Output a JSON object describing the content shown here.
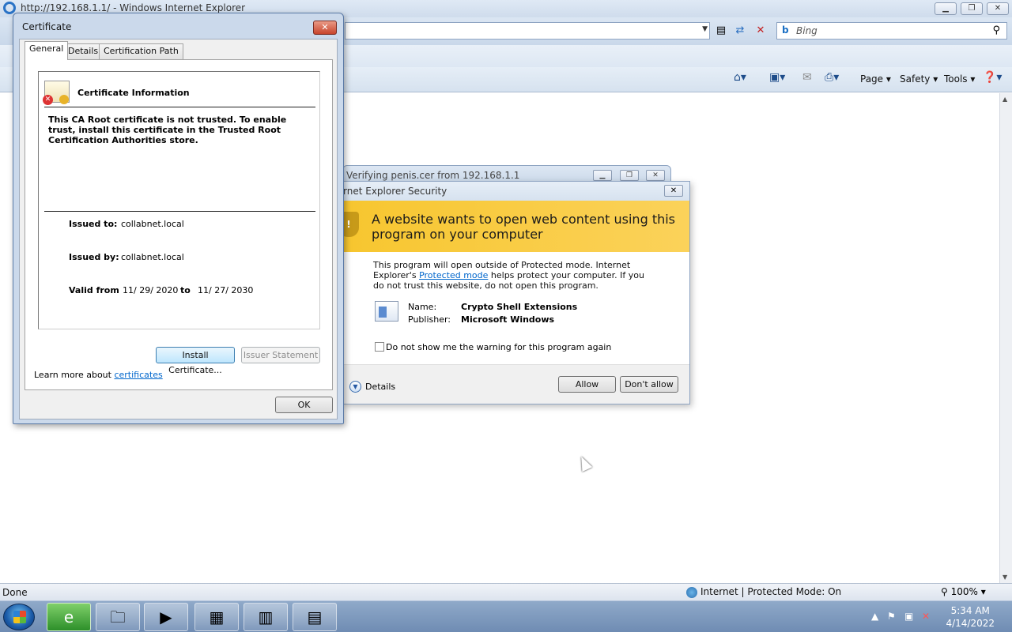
{
  "ie": {
    "title": "http://192.168.1.1/ - Windows Internet Explorer",
    "search_placeholder": "Bing",
    "commands": [
      "Page",
      "Safety",
      "Tools"
    ],
    "status": "Done",
    "zone": "Internet | Protected Mode: On",
    "zoom": "100%"
  },
  "certificate": {
    "title": "Certificate",
    "tabs": [
      "General",
      "Details",
      "Certification Path"
    ],
    "info_title": "Certificate Information",
    "warning": "This CA Root certificate is not trusted. To enable trust, install this certificate in the Trusted Root Certification Authorities store.",
    "issued_to_label": "Issued to:",
    "issued_to": "collabnet.local",
    "issued_by_label": "Issued by:",
    "issued_by": "collabnet.local",
    "valid_from_label": "Valid from",
    "valid_from": "11/ 29/ 2020",
    "to_label": "to",
    "valid_to": "11/ 27/ 2030",
    "install_button": "Install Certificate...",
    "issuer_button": "Issuer Statement",
    "learn_more": "Learn more about",
    "learn_link": "certificates",
    "ok_button": "OK"
  },
  "verify": {
    "title": "Verifying penis.cer from 192.168.1.1"
  },
  "security": {
    "title": "rnet Explorer Security",
    "banner": "A website wants to open web content using this program on your computer",
    "msg_pre": "This program will open outside of Protected mode. Internet Explorer's",
    "msg_link": "Protected mode",
    "msg_post": "helps protect your computer. If you do not trust this website, do not open this program.",
    "name_label": "Name:",
    "name": "Crypto Shell Extensions",
    "publisher_label": "Publisher:",
    "publisher": "Microsoft Windows",
    "checkbox_label": "Do not show me the warning for this program again",
    "details": "Details",
    "allow": "Allow",
    "dont_allow": "Don't allow"
  },
  "taskbar": {
    "time": "5:34 AM",
    "date": "4/14/2022"
  }
}
